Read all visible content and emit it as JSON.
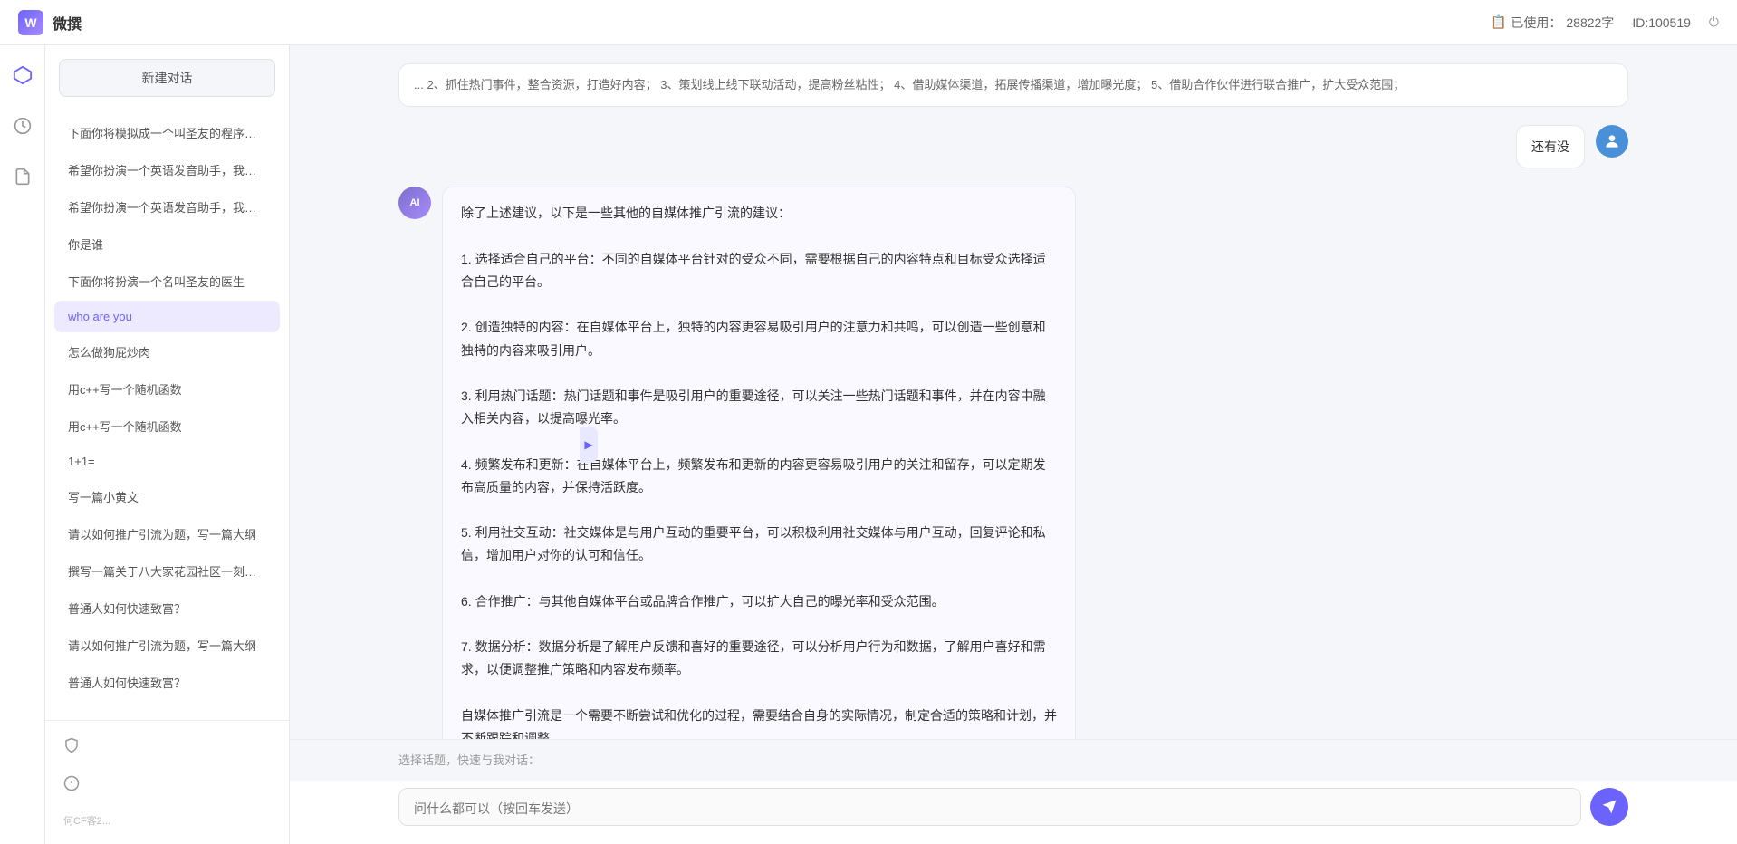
{
  "header": {
    "logo_text": "W",
    "title": "微撰",
    "usage_label": "已使用：",
    "usage_value": "28822字",
    "usage_icon": "📋",
    "id_label": "ID:100519",
    "power_icon": "⏻"
  },
  "sidebar": {
    "new_conversation": "新建对话",
    "items": [
      {
        "id": 1,
        "label": "下面你将模拟成一个叫圣友的程序员，我说...",
        "active": false
      },
      {
        "id": 2,
        "label": "希望你扮演一个英语发音助手，我提供给你...",
        "active": false
      },
      {
        "id": 3,
        "label": "希望你扮演一个英语发音助手，我提供给你...",
        "active": false
      },
      {
        "id": 4,
        "label": "你是谁",
        "active": false
      },
      {
        "id": 5,
        "label": "下面你将扮演一个名叫圣友的医生",
        "active": false
      },
      {
        "id": 6,
        "label": "who are you",
        "active": true
      },
      {
        "id": 7,
        "label": "怎么做狗屁炒肉",
        "active": false
      },
      {
        "id": 8,
        "label": "用c++写一个随机函数",
        "active": false
      },
      {
        "id": 9,
        "label": "用c++写一个随机函数",
        "active": false
      },
      {
        "id": 10,
        "label": "1+1=",
        "active": false
      },
      {
        "id": 11,
        "label": "写一篇小黄文",
        "active": false
      },
      {
        "id": 12,
        "label": "请以如何推广引流为题，写一篇大纲",
        "active": false
      },
      {
        "id": 13,
        "label": "撰写一篇关于八大家花园社区一刻钟便民生...",
        "active": false
      },
      {
        "id": 14,
        "label": "普通人如何快速致富？",
        "active": false
      },
      {
        "id": 15,
        "label": "请以如何推广引流为题，写一篇大纲",
        "active": false
      },
      {
        "id": 16,
        "label": "普通人如何快速致富？",
        "active": false
      }
    ],
    "bottom_items": [
      {
        "id": "shield",
        "icon": "🛡",
        "label": ""
      },
      {
        "id": "info",
        "icon": "ℹ",
        "label": ""
      },
      {
        "id": "more",
        "icon": "...",
        "label": ""
      }
    ]
  },
  "chat": {
    "top_partial_message": "... 2、抓住热门事件，整合资源，打造好内容； 3、策划线上线下联动活动，提高粉丝粘性； 4、借助媒体渠道，拓展传播渠道，增加曝光度； 5、借助合作伙伴进行联合推广，扩大受众范围；",
    "messages": [
      {
        "role": "user",
        "avatar_text": "U",
        "content": "还有没"
      },
      {
        "role": "ai",
        "avatar_text": "AI",
        "content": "除了上述建议，以下是一些其他的自媒体推广引流的建议：\n\n1. 选择适合自己的平台：不同的自媒体平台针对的受众不同，需要根据自己的内容特点和目标受众选择适合自己的平台。\n\n2. 创造独特的内容：在自媒体平台上，独特的内容更容易吸引用户的注意力和共鸣，可以创造一些创意和独特的内容来吸引用户。\n\n3. 利用热门话题：热门话题和事件是吸引用户的重要途径，可以关注一些热门话题和事件，并在内容中融入相关内容，以提高曝光率。\n\n4. 频繁发布和更新：在自媒体平台上，频繁发布和更新的内容更容易吸引用户的关注和留存，可以定期发布高质量的内容，并保持活跃度。\n\n5. 利用社交互动：社交媒体是与用户互动的重要平台，可以积极利用社交媒体与用户互动，回复评论和私信，增加用户对你的认可和信任。\n\n6. 合作推广：与其他自媒体平台或品牌合作推广，可以扩大自己的曝光率和受众范围。\n\n7. 数据分析：数据分析是了解用户反馈和喜好的重要途径，可以分析用户行为和数据，了解用户喜好和需求，以便调整推广策略和内容发布频率。\n\n自媒体推广引流是一个需要不断尝试和优化的过程，需要结合自身的实际情况，制定合适的策略和计划，并不断跟踪和调整。"
      }
    ]
  },
  "input": {
    "quick_select_label": "选择话题，快速与我对话：",
    "placeholder": "问什么都可以（按回车发送）",
    "send_icon": "➤"
  },
  "icons": {
    "collapse": "▶",
    "hexagon": "⬡",
    "clock": "🕐",
    "doc": "📄",
    "shield": "🛡",
    "info": "ℹ"
  }
}
